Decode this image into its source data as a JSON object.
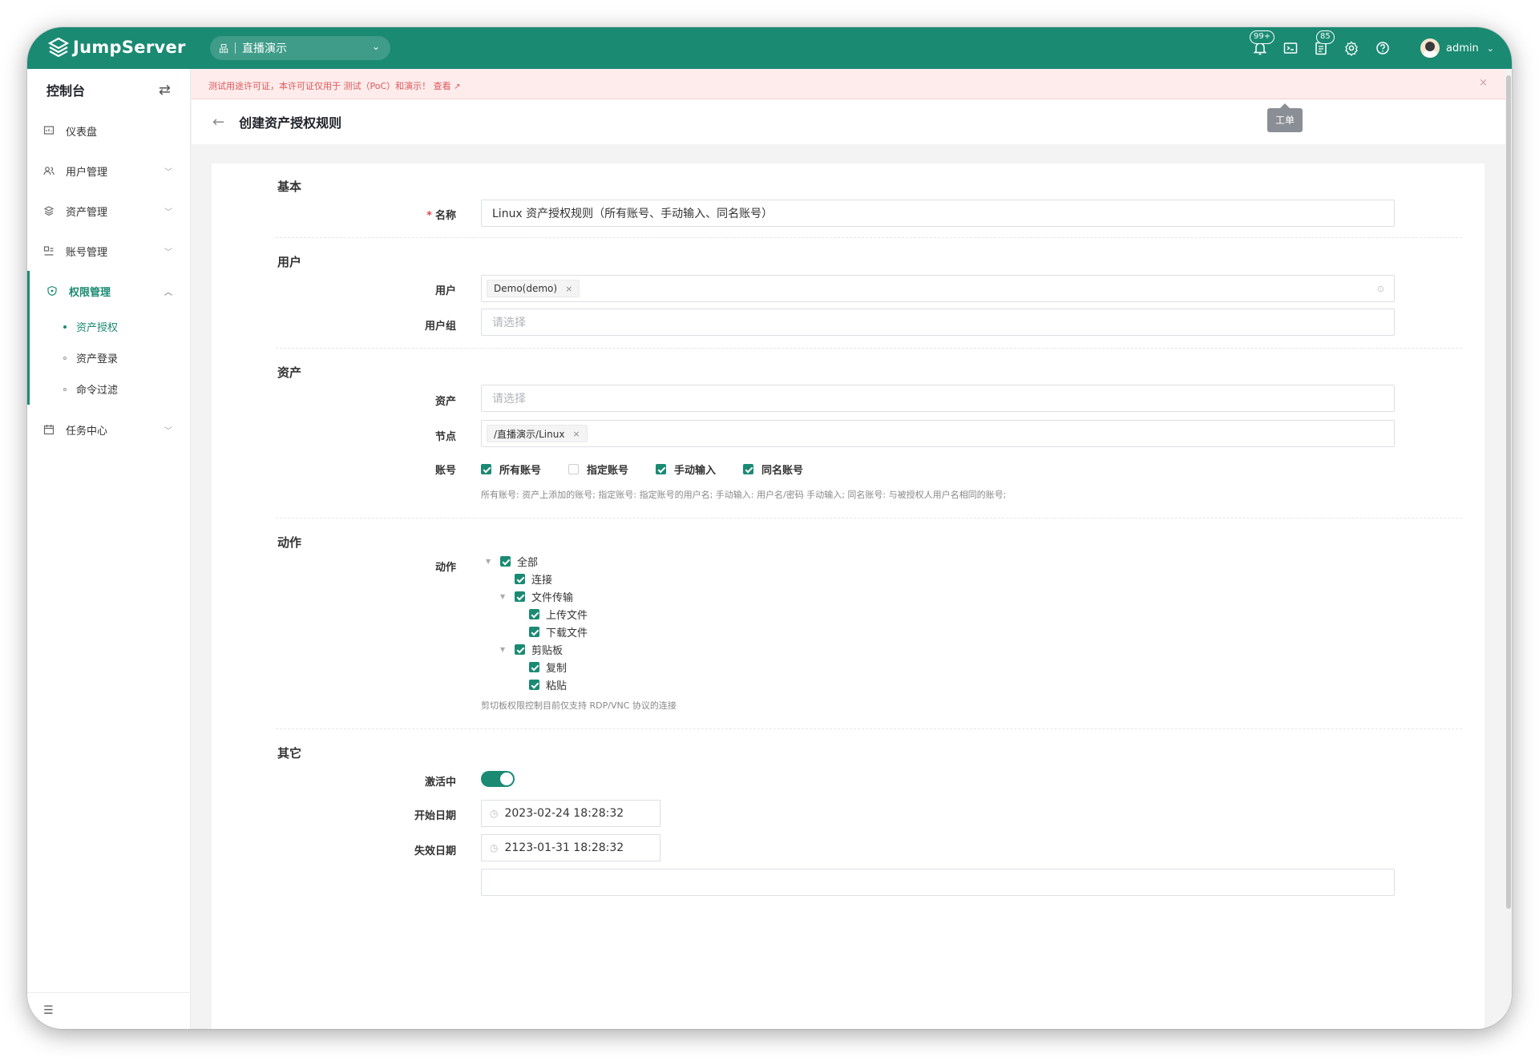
{
  "app": {
    "logo_text": "JumpServer",
    "org": "直播演示"
  },
  "topbar": {
    "badges": {
      "notifications": "99+",
      "tickets": "85"
    },
    "tooltip": "工单",
    "user": "admin"
  },
  "sidebar": {
    "title": "控制台",
    "items": [
      {
        "label": "仪表盘"
      },
      {
        "label": "用户管理"
      },
      {
        "label": "资产管理"
      },
      {
        "label": "账号管理"
      },
      {
        "label": "权限管理"
      },
      {
        "label": "任务中心"
      }
    ],
    "subitems": [
      {
        "label": "资产授权"
      },
      {
        "label": "资产登录"
      },
      {
        "label": "命令过滤"
      }
    ]
  },
  "alert": {
    "text": "测试用途许可证，本许可证仅用于 测试（PoC）和演示！ 查看"
  },
  "page": {
    "title": "创建资产授权规则"
  },
  "form": {
    "basic": {
      "section": "基本",
      "name_label": "名称",
      "name_value": "Linux 资产授权规则（所有账号、手动输入、同名账号）"
    },
    "users": {
      "section": "用户",
      "user_label": "用户",
      "user_tag": "Demo(demo)",
      "group_label": "用户组",
      "group_placeholder": "请选择"
    },
    "assets": {
      "section": "资产",
      "asset_label": "资产",
      "asset_placeholder": "请选择",
      "node_label": "节点",
      "node_tag": "/直播演示/Linux",
      "account_label": "账号",
      "account_options": [
        {
          "label": "所有账号",
          "checked": true
        },
        {
          "label": "指定账号",
          "checked": false
        },
        {
          "label": "手动输入",
          "checked": true
        },
        {
          "label": "同名账号",
          "checked": true
        }
      ],
      "account_help": "所有账号: 资产上添加的账号; 指定账号: 指定账号的用户名; 手动输入: 用户名/密码 手动输入; 同名账号: 与被授权人用户名相同的账号;"
    },
    "actions": {
      "section": "动作",
      "label": "动作",
      "tree": [
        {
          "label": "全部"
        },
        {
          "label": "连接"
        },
        {
          "label": "文件传输"
        },
        {
          "label": "上传文件"
        },
        {
          "label": "下载文件"
        },
        {
          "label": "剪贴板"
        },
        {
          "label": "复制"
        },
        {
          "label": "粘贴"
        }
      ],
      "help": "剪切板权限控制目前仅支持 RDP/VNC 协议的连接"
    },
    "other": {
      "section": "其它",
      "active_label": "激活中",
      "active": true,
      "start_label": "开始日期",
      "start_value": "2023-02-24 18:28:32",
      "end_label": "失效日期",
      "end_value": "2123-01-31 18:28:32"
    }
  },
  "colors": {
    "brand": "#1a8a73",
    "alert_text": "#e0575b",
    "alert_bg": "#fdeceb"
  }
}
